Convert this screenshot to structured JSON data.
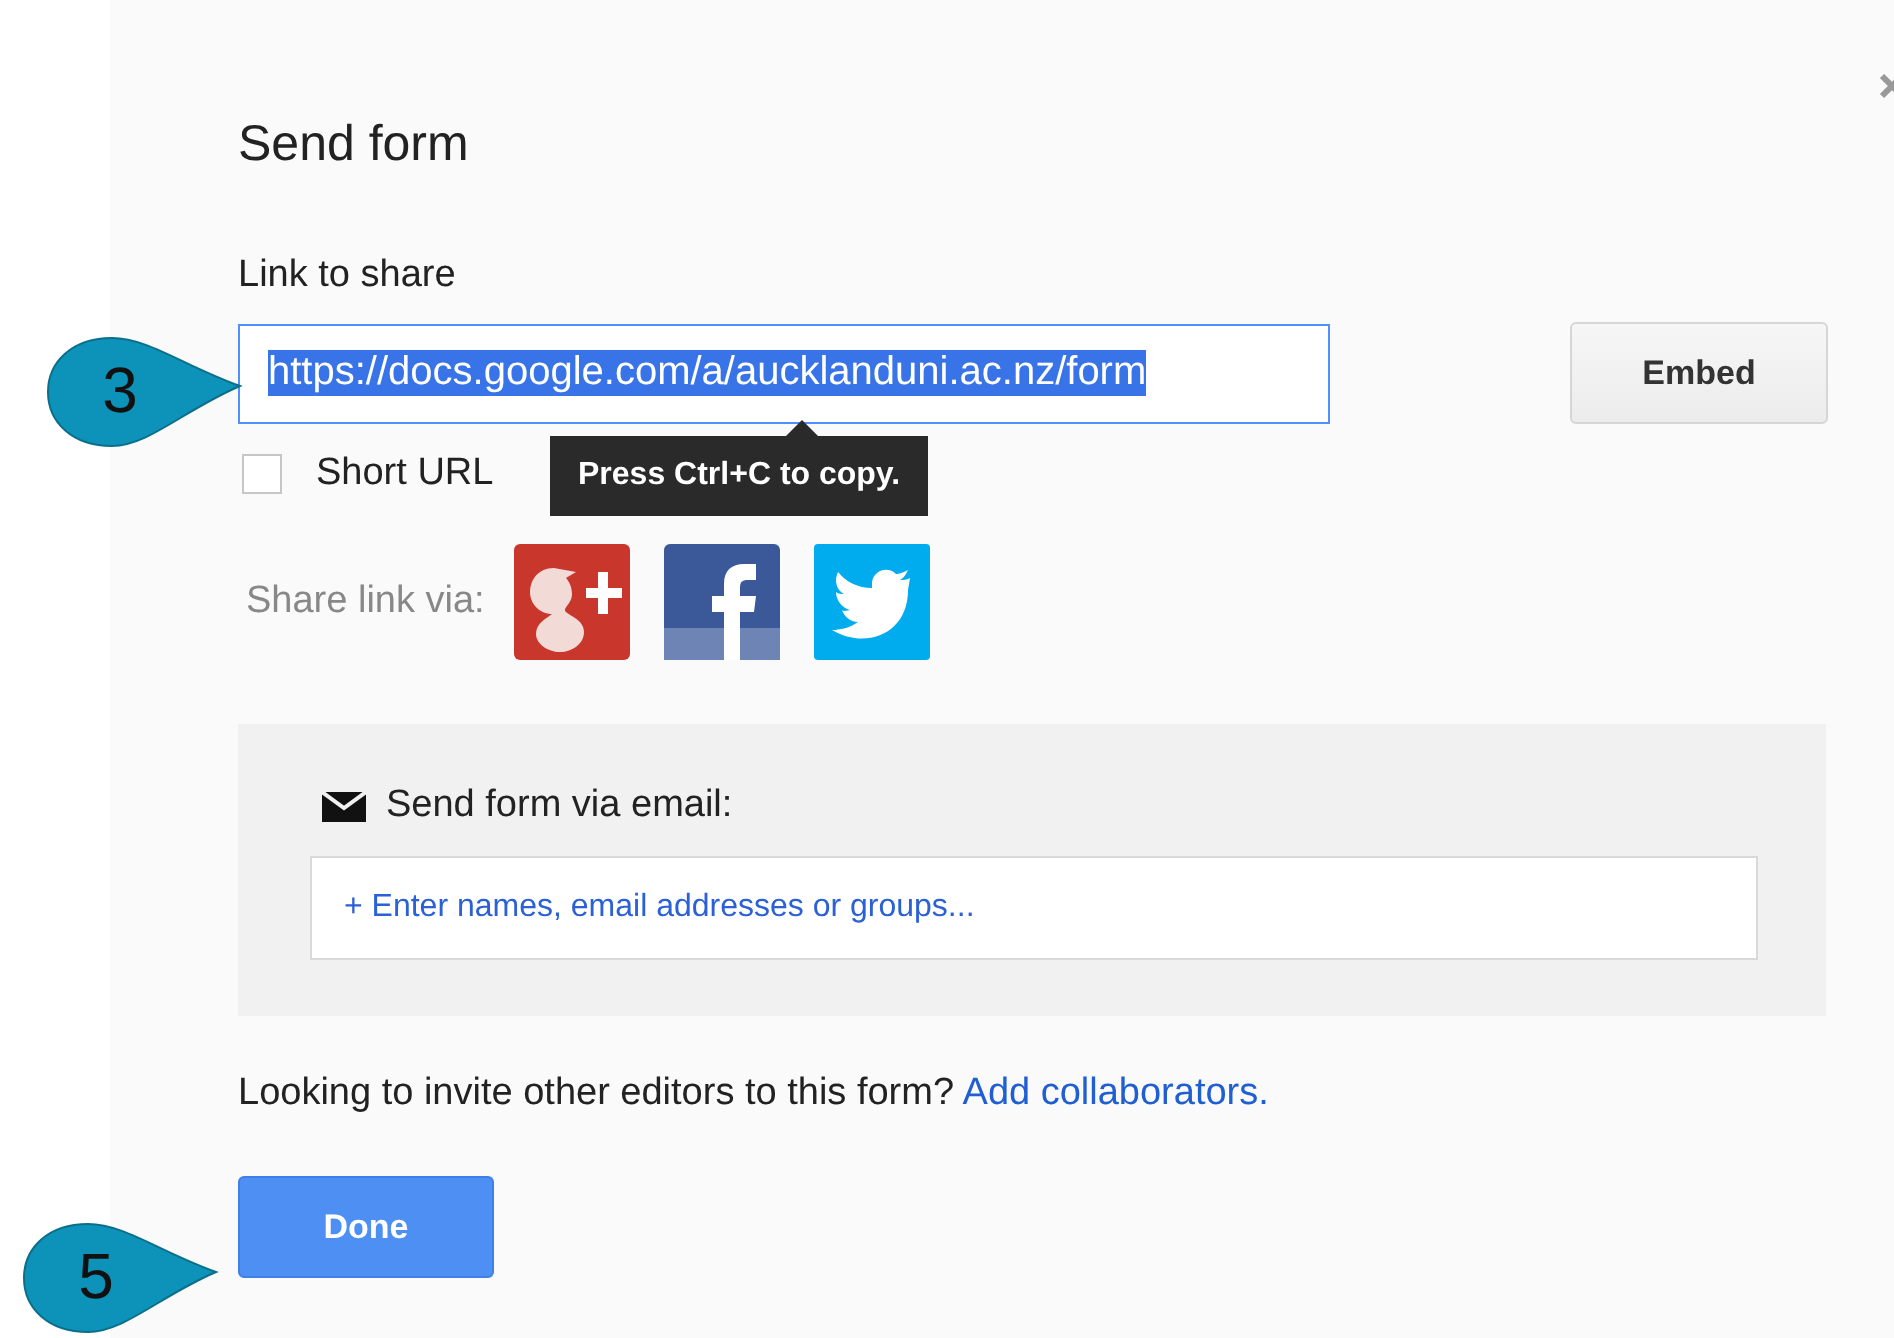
{
  "dialog": {
    "title": "Send form",
    "link": {
      "label": "Link to share",
      "value": "https://docs.google.com/a/aucklanduni.ac.nz/form",
      "selected": true
    },
    "embed_button": "Embed",
    "short_url": {
      "label": "Short URL",
      "checked": false
    },
    "tooltip": "Press Ctrl+C to copy.",
    "share": {
      "label": "Share link via:"
    },
    "email": {
      "label": "Send form via email:",
      "placeholder": "+ Enter names, email addresses or groups..."
    },
    "footer": {
      "text": "Looking to invite other editors to this form?",
      "link": "Add collaborators."
    },
    "done_button": "Done"
  },
  "callouts": [
    {
      "number": "3"
    },
    {
      "number": "5"
    }
  ]
}
